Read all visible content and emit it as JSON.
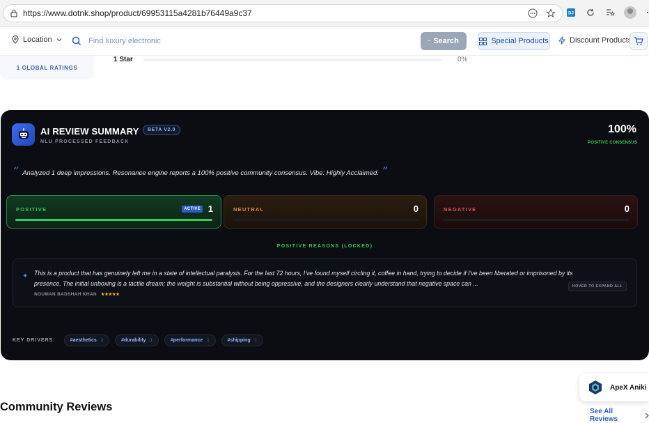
{
  "browser": {
    "url": "https://www.dotnk.shop/product/69953115a4281b76449a9c37"
  },
  "header": {
    "location_label": "Location",
    "search_placeholder": "Find luxury electronic",
    "search_button": "Search",
    "special_products": "Special Products",
    "discount_products": "Discount Products"
  },
  "ratings": {
    "global_ratings": "1 GLOBAL RATINGS",
    "star_row_label": "1 Star",
    "star_row_pct": "0%",
    "star_row_fill": 0
  },
  "ai_summary": {
    "title": "AI REVIEW SUMMARY",
    "beta": "BETA V2.0",
    "subtitle": "NLU PROCESSED FEEDBACK",
    "consensus_pct": "100%",
    "consensus_label": "POSITIVE CONSENSUS",
    "quote": "Analyzed 1 deep impressions. Resonance engine reports a 100% positive community consensus. Vibe: Highly Acclaimed.",
    "sentiments": [
      {
        "label": "POSITIVE",
        "count": "1",
        "active_badge": "ACTIVE",
        "fill": 1.0,
        "color": "#2ed15e"
      },
      {
        "label": "NEUTRAL",
        "count": "0",
        "fill": 0,
        "color": "#e08a3c"
      },
      {
        "label": "NEGATIVE",
        "count": "0",
        "fill": 0,
        "color": "#e0504a"
      }
    ],
    "reasons_title": "POSITIVE REASONS (LOCKED)",
    "review": {
      "text": "This is a product that has genuinely left me in a state of intellectual paralysis. For the last 72 hours, I've found myself circling it, coffee in hand, trying to decide if I've been liberated or imprisoned by its presence. The initial unboxing is a tactile dream; the weight is substantial without being oppressive, and the designers clearly understand that negative space can ...",
      "author": "NOUMAN BADSHAH KHAN",
      "stars": "★★★★★",
      "hover_hint": "HOVER TO EXPAND ALL"
    },
    "drivers_label": "KEY DRIVERS:",
    "drivers": [
      {
        "tag": "#aesthetics",
        "count": "2"
      },
      {
        "tag": "#durability",
        "count": "1"
      },
      {
        "tag": "#performance",
        "count": "1"
      },
      {
        "tag": "#shipping",
        "count": "1"
      }
    ]
  },
  "community": {
    "title": "Community Reviews",
    "see_all": "See All Reviews"
  },
  "floating": {
    "name": "ApeX Aniki"
  }
}
